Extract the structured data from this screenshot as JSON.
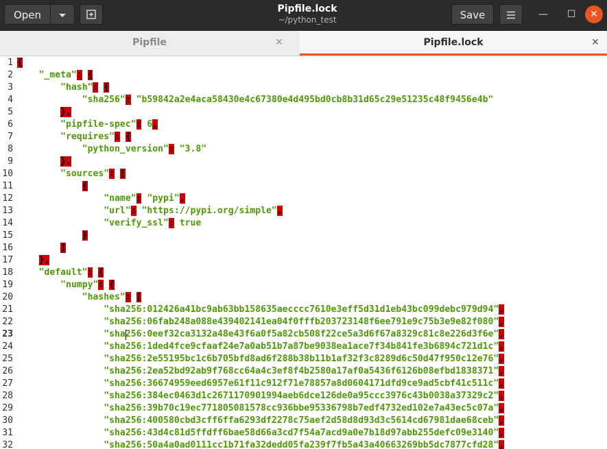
{
  "header": {
    "open_label": "Open",
    "open_menu_icon": "caret-down-icon",
    "new_tab_icon": "new-tab-icon",
    "title": "Pipfile.lock",
    "subtitle": "~/python_test",
    "save_label": "Save",
    "menu_icon": "hamburger-menu-icon",
    "minimize_glyph": "—",
    "maximize_glyph": "☐",
    "close_glyph": "✕"
  },
  "tabs": [
    {
      "label": "Pipfile",
      "active": false,
      "close_glyph": "✕"
    },
    {
      "label": "Pipfile.lock",
      "active": true,
      "close_glyph": "✕"
    }
  ],
  "editor": {
    "current_line": 23,
    "lines": [
      {
        "n": "1",
        "t": "{"
      },
      {
        "n": "2",
        "t": "    \"_meta\": {"
      },
      {
        "n": "3",
        "t": "        \"hash\": {"
      },
      {
        "n": "4",
        "t": "            \"sha256\": \"b59842a2e4aca58430e4c67380e4d495bd0cb8b31d65c29e51235c48f9456e4b\""
      },
      {
        "n": "5",
        "t": "        },"
      },
      {
        "n": "6",
        "t": "        \"pipfile-spec\": 6,"
      },
      {
        "n": "7",
        "t": "        \"requires\": {"
      },
      {
        "n": "8",
        "t": "            \"python_version\": \"3.8\""
      },
      {
        "n": "9",
        "t": "        },"
      },
      {
        "n": "10",
        "t": "        \"sources\": ["
      },
      {
        "n": "11",
        "t": "            {"
      },
      {
        "n": "12",
        "t": "                \"name\": \"pypi\","
      },
      {
        "n": "13",
        "t": "                \"url\": \"https://pypi.org/simple\","
      },
      {
        "n": "14",
        "t": "                \"verify_ssl\": true"
      },
      {
        "n": "15",
        "t": "            }"
      },
      {
        "n": "16",
        "t": "        ]"
      },
      {
        "n": "17",
        "t": "    },"
      },
      {
        "n": "18",
        "t": "    \"default\": {"
      },
      {
        "n": "19",
        "t": "        \"numpy\": {"
      },
      {
        "n": "20",
        "t": "            \"hashes\": ["
      },
      {
        "n": "21",
        "t": "                \"sha256:012426a41bc9ab63bb158635aecccc7610e3eff5d31d1eb43bc099debc979d94\","
      },
      {
        "n": "22",
        "t": "                \"sha256:06fab248a088e439402141ea04f0fffb203723148f6ee791e9c75b3e9e82f080\","
      },
      {
        "n": "23",
        "t": "                \"sha256:0eef32ca3132a48e43f6a0f5a82cb508f22ce5a3d6f67a8329c81c8e226d3f6e\","
      },
      {
        "n": "24",
        "t": "                \"sha256:1ded4fce9cfaaf24e7a0ab51b7a87be9038ea1ace7f34b841fe3b6894c721d1c\","
      },
      {
        "n": "25",
        "t": "                \"sha256:2e55195bc1c6b705bfd8ad6f288b38b11b1af32f3c8289d6c50d47f950c12e76\","
      },
      {
        "n": "26",
        "t": "                \"sha256:2ea52bd92ab9f768cc64a4c3ef8f4b2580a17af0a5436f6126b08efbd1838371\","
      },
      {
        "n": "27",
        "t": "                \"sha256:36674959eed6957e61f11c912f71e78857a8d0604171dfd9ce9ad5cbf41c511c\","
      },
      {
        "n": "28",
        "t": "                \"sha256:384ec0463d1c2671170901994aeb6dce126de0a95ccc3976c43b0038a37329c2\","
      },
      {
        "n": "29",
        "t": "                \"sha256:39b70c19ec771805081578cc936bbe95336798b7edf4732ed102e7a43ec5c07a\","
      },
      {
        "n": "30",
        "t": "                \"sha256:400580cbd3cff6ffa6293df2278c75aef2d58d8d93d3c5614cd67981dae68ceb\","
      },
      {
        "n": "31",
        "t": "                \"sha256:43d4c81d5ffdff6bae58d66a3cd7f54a7acd9a0e7b18d97abb255defc09e3140\","
      },
      {
        "n": "32",
        "t": "                \"sha256:50a4a0ad0111cc1b71fa32dedd05fa239f7fb5a43a40663269bb5dc7877cfd28\","
      }
    ]
  },
  "colors": {
    "header_bg": "#2b2b2b",
    "accent": "#e95420",
    "code_text": "#4e9a06",
    "bracket_highlight": "#cc0000"
  }
}
